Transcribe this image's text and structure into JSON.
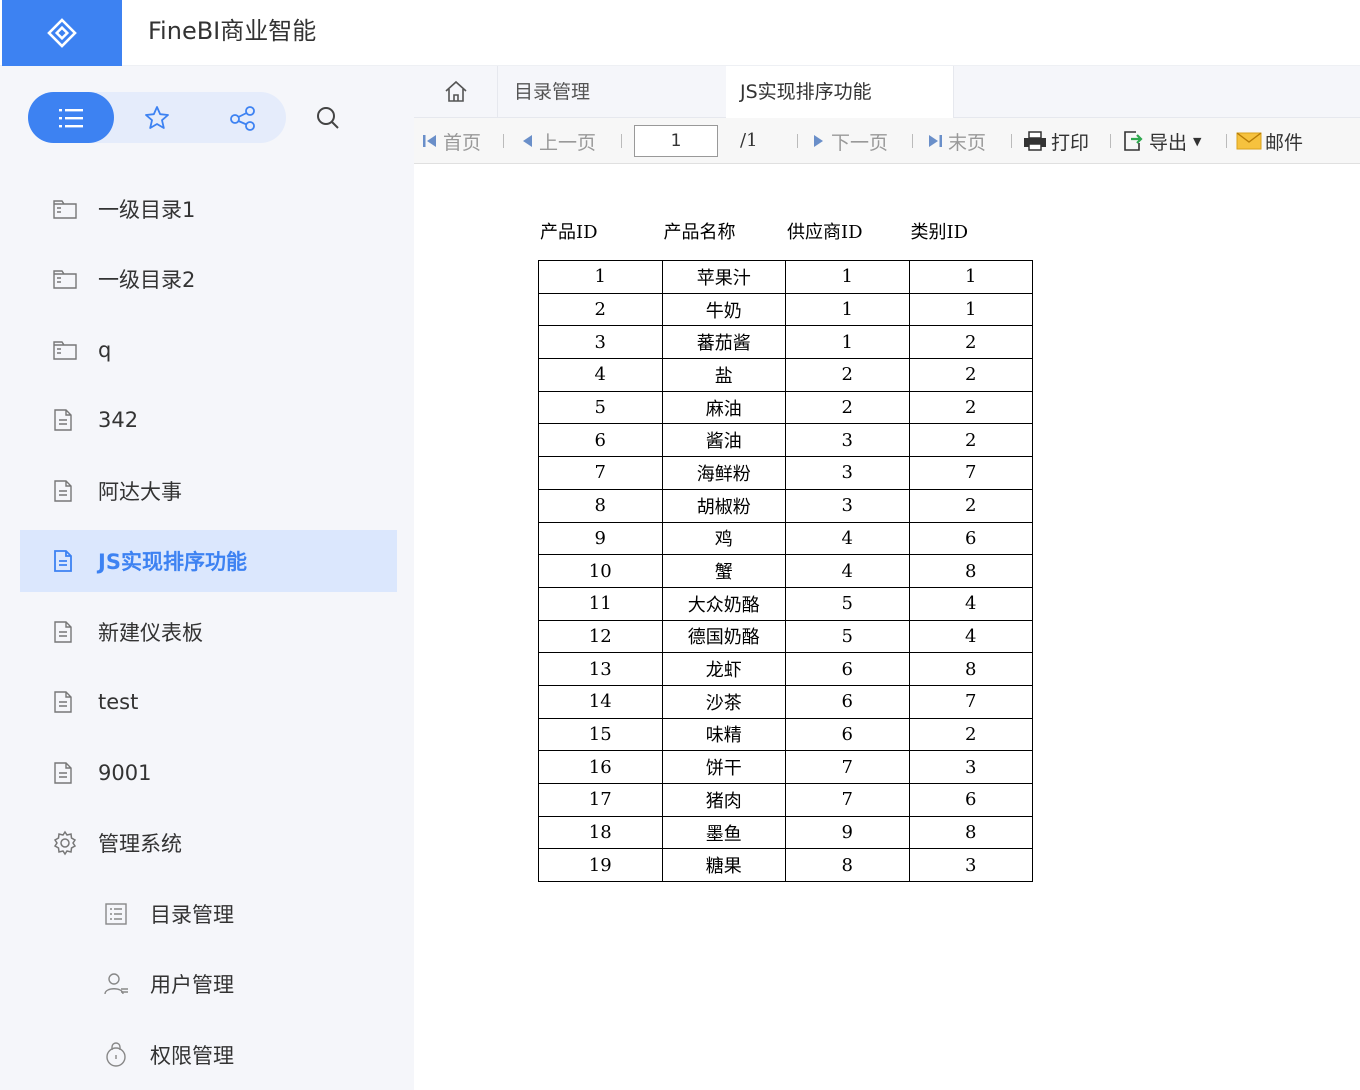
{
  "app": {
    "title": "FineBI商业智能"
  },
  "sidebar": {
    "items": [
      {
        "label": "一级目录1",
        "icon": "folder-icon"
      },
      {
        "label": "一级目录2",
        "icon": "folder-icon"
      },
      {
        "label": "q",
        "icon": "folder-icon"
      },
      {
        "label": "342",
        "icon": "document-icon"
      },
      {
        "label": "阿达大事",
        "icon": "document-icon"
      },
      {
        "label": "JS实现排序功能",
        "icon": "document-icon",
        "active": true
      },
      {
        "label": "新建仪表板",
        "icon": "document-icon"
      },
      {
        "label": "test",
        "icon": "document-icon"
      },
      {
        "label": "9001",
        "icon": "document-icon"
      },
      {
        "label": "管理系统",
        "icon": "gear-icon"
      },
      {
        "label": "目录管理",
        "icon": "list-icon"
      },
      {
        "label": "用户管理",
        "icon": "user-icon"
      },
      {
        "label": "权限管理",
        "icon": "lock-icon"
      }
    ]
  },
  "tabs": [
    {
      "label": "目录管理"
    },
    {
      "label": "JS实现排序功能",
      "active": true
    }
  ],
  "toolbar": {
    "first": "首页",
    "prev": "上一页",
    "page_value": "1",
    "page_total": "/1",
    "next": "下一页",
    "last": "末页",
    "print": "打印",
    "export": "导出",
    "email": "邮件"
  },
  "report": {
    "headers": [
      "产品ID",
      "产品名称",
      "供应商ID",
      "类别ID"
    ],
    "rows": [
      [
        "1",
        "苹果汁",
        "1",
        "1"
      ],
      [
        "2",
        "牛奶",
        "1",
        "1"
      ],
      [
        "3",
        "蕃茄酱",
        "1",
        "2"
      ],
      [
        "4",
        "盐",
        "2",
        "2"
      ],
      [
        "5",
        "麻油",
        "2",
        "2"
      ],
      [
        "6",
        "酱油",
        "3",
        "2"
      ],
      [
        "7",
        "海鲜粉",
        "3",
        "7"
      ],
      [
        "8",
        "胡椒粉",
        "3",
        "2"
      ],
      [
        "9",
        "鸡",
        "4",
        "6"
      ],
      [
        "10",
        "蟹",
        "4",
        "8"
      ],
      [
        "11",
        "大众奶酪",
        "5",
        "4"
      ],
      [
        "12",
        "德国奶酪",
        "5",
        "4"
      ],
      [
        "13",
        "龙虾",
        "6",
        "8"
      ],
      [
        "14",
        "沙茶",
        "6",
        "7"
      ],
      [
        "15",
        "味精",
        "6",
        "2"
      ],
      [
        "16",
        "饼干",
        "7",
        "3"
      ],
      [
        "17",
        "猪肉",
        "7",
        "6"
      ],
      [
        "18",
        "墨鱼",
        "9",
        "8"
      ],
      [
        "19",
        "糖果",
        "8",
        "3"
      ]
    ]
  },
  "colors": {
    "accent": "#3d82f2",
    "active_bg": "#dbe7fd",
    "sidebar_bg": "#f5f6fa"
  }
}
